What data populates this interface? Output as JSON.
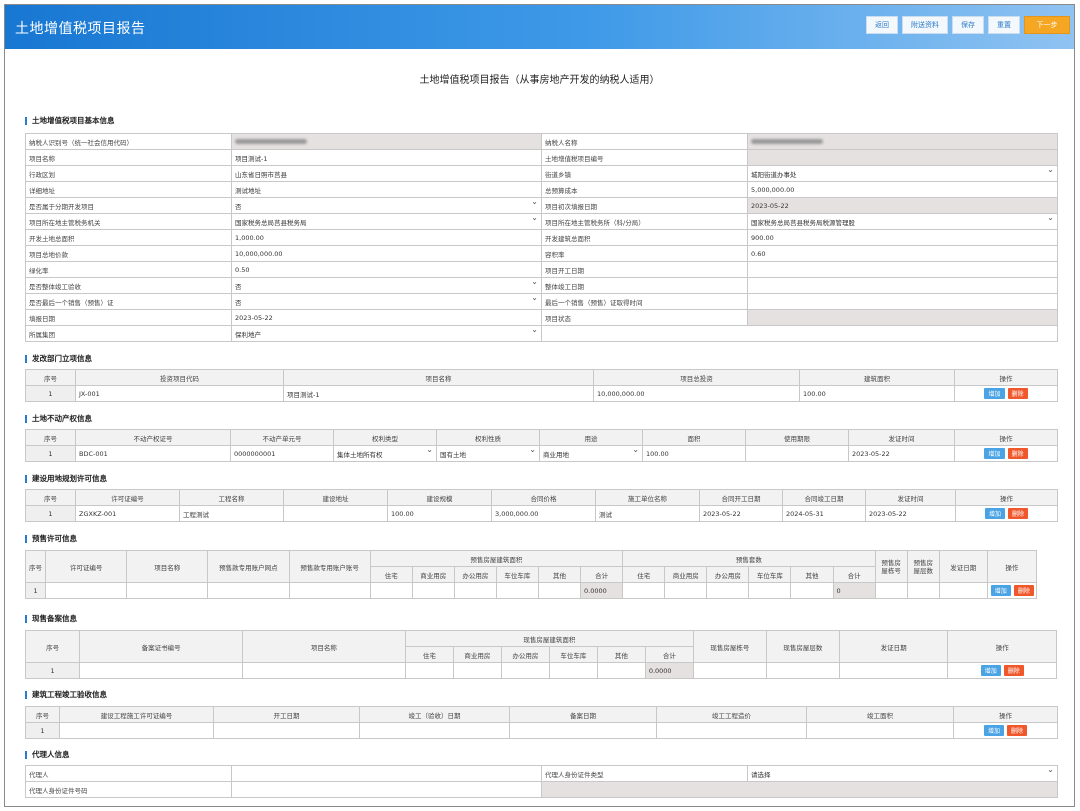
{
  "app": {
    "title": "土地增值税项目报告",
    "buttons": {
      "back": "返回",
      "attach": "附送资料",
      "save": "保存",
      "reset": "重置",
      "next": "下一步"
    }
  },
  "report_title": "土地增值税项目报告（从事房地产开发的纳税人适用）",
  "sections": {
    "basic": "土地增值税项目基本信息",
    "devreform": "发改部门立项信息",
    "land": "土地不动产权信息",
    "planning": "建设用地规划许可信息",
    "presale": "预售许可信息",
    "existing": "现售备案信息",
    "completion": "建筑工程竣工验收信息",
    "agent": "代理人信息"
  },
  "basic": {
    "r1": {
      "l1": "纳税人识别号（统一社会信用代码）",
      "l2": "纳税人名称"
    },
    "r2": {
      "l1": "项目名称",
      "v1": "项目测试-1",
      "l2": "土地增值税项目编号",
      "v2": ""
    },
    "r3": {
      "l1": "行政区划",
      "v1": "山东省日照市莒县",
      "l2": "街道乡镇",
      "v2": "城阳街道办事处"
    },
    "r4": {
      "l1": "详细地址",
      "v1": "测试地址",
      "l2": "总预算成本",
      "v2": "5,000,000.00"
    },
    "r5": {
      "l1": "是否属于分期开发项目",
      "v1": "否",
      "l2": "项目初次填报日期",
      "v2": "2023-05-22"
    },
    "r6": {
      "l1": "项目所在地主管税务机关",
      "v1": "国家税务总局莒县税务局",
      "l2": "项目所在地主管税务所（科/分局）",
      "v2": "国家税务总局莒县税务局税源管理股"
    },
    "r7": {
      "l1": "开发土地总面积",
      "v1": "1,000.00",
      "l2": "开发建筑总面积",
      "v2": "900.00"
    },
    "r8": {
      "l1": "项目总地价款",
      "v1": "10,000,000.00",
      "l2": "容积率",
      "v2": "0.60"
    },
    "r9": {
      "l1": "绿化率",
      "v1": "0.50",
      "l2": "项目开工日期",
      "v2": ""
    },
    "r10": {
      "l1": "是否整体竣工验收",
      "v1": "否",
      "l2": "整体竣工日期",
      "v2": ""
    },
    "r11": {
      "l1": "是否最后一个销售（预售）证",
      "v1": "否",
      "l2": "最后一个销售（预售）证取得时间",
      "v2": ""
    },
    "r12": {
      "l1": "填报日期",
      "v1": "2023-05-22",
      "l2": "项目状态",
      "v2": ""
    },
    "r13": {
      "l1": "所属集团",
      "v1": "保利地产"
    }
  },
  "devreform": {
    "headers": [
      "序号",
      "投资项目代码",
      "项目名称",
      "项目总投资",
      "建筑面积",
      "操作"
    ],
    "row": [
      "1",
      "JX-001",
      "项目测试-1",
      "10,000,000.00",
      "100.00"
    ]
  },
  "land": {
    "headers": [
      "序号",
      "不动产权证号",
      "不动产单元号",
      "权利类型",
      "权利性质",
      "用途",
      "面积",
      "使用期限",
      "发证时间",
      "操作"
    ],
    "row": [
      "1",
      "BDC-001",
      "0000000001",
      "集体土地所有权",
      "国有土地",
      "商业用地",
      "100.00",
      "",
      "2023-05-22"
    ]
  },
  "planning": {
    "headers": [
      "序号",
      "许可证编号",
      "工程名称",
      "建设地址",
      "建设规模",
      "合同价格",
      "施工单位名称",
      "合同开工日期",
      "合同竣工日期",
      "发证时间",
      "操作"
    ],
    "row": [
      "1",
      "ZGXKZ-001",
      "工程测试",
      "",
      "100.00",
      "3,000,000.00",
      "测试",
      "2023-05-22",
      "2024-05-31",
      "2023-05-22"
    ]
  },
  "presale": {
    "headers": [
      "序号",
      "许可证编号",
      "项目名称",
      "预售款专用账户网点",
      "预售款专用账户账号",
      "预售房屋建筑面积",
      "预售套数",
      "预售房屋栋号",
      "预售房屋层数",
      "发证日期",
      "操作"
    ],
    "sub": [
      "住宅",
      "商业用房",
      "办公用房",
      "车位车库",
      "其他",
      "合计"
    ],
    "row": [
      "1"
    ],
    "area_total": "0.0000",
    "count_total": "0"
  },
  "existing": {
    "headers": [
      "序号",
      "备案证书编号",
      "项目名称",
      "现售房屋建筑面积",
      "现售房屋栋号",
      "现售房屋层数",
      "发证日期",
      "操作"
    ],
    "sub": [
      "住宅",
      "商业用房",
      "办公用房",
      "车位车库",
      "其他",
      "合计"
    ],
    "row": [
      "1"
    ],
    "area_total": "0.0000"
  },
  "completion": {
    "headers": [
      "序号",
      "建设工程施工许可证编号",
      "开工日期",
      "竣工（验收）日期",
      "备案日期",
      "竣工工程造价",
      "竣工面积",
      "操作"
    ],
    "row": [
      "1"
    ]
  },
  "agent": {
    "l1": "代理人",
    "l2": "代理人身份证件类型",
    "v2": "请选择",
    "l3": "代理人身份证件号码"
  },
  "ops": {
    "add": "增加",
    "del": "删除"
  }
}
